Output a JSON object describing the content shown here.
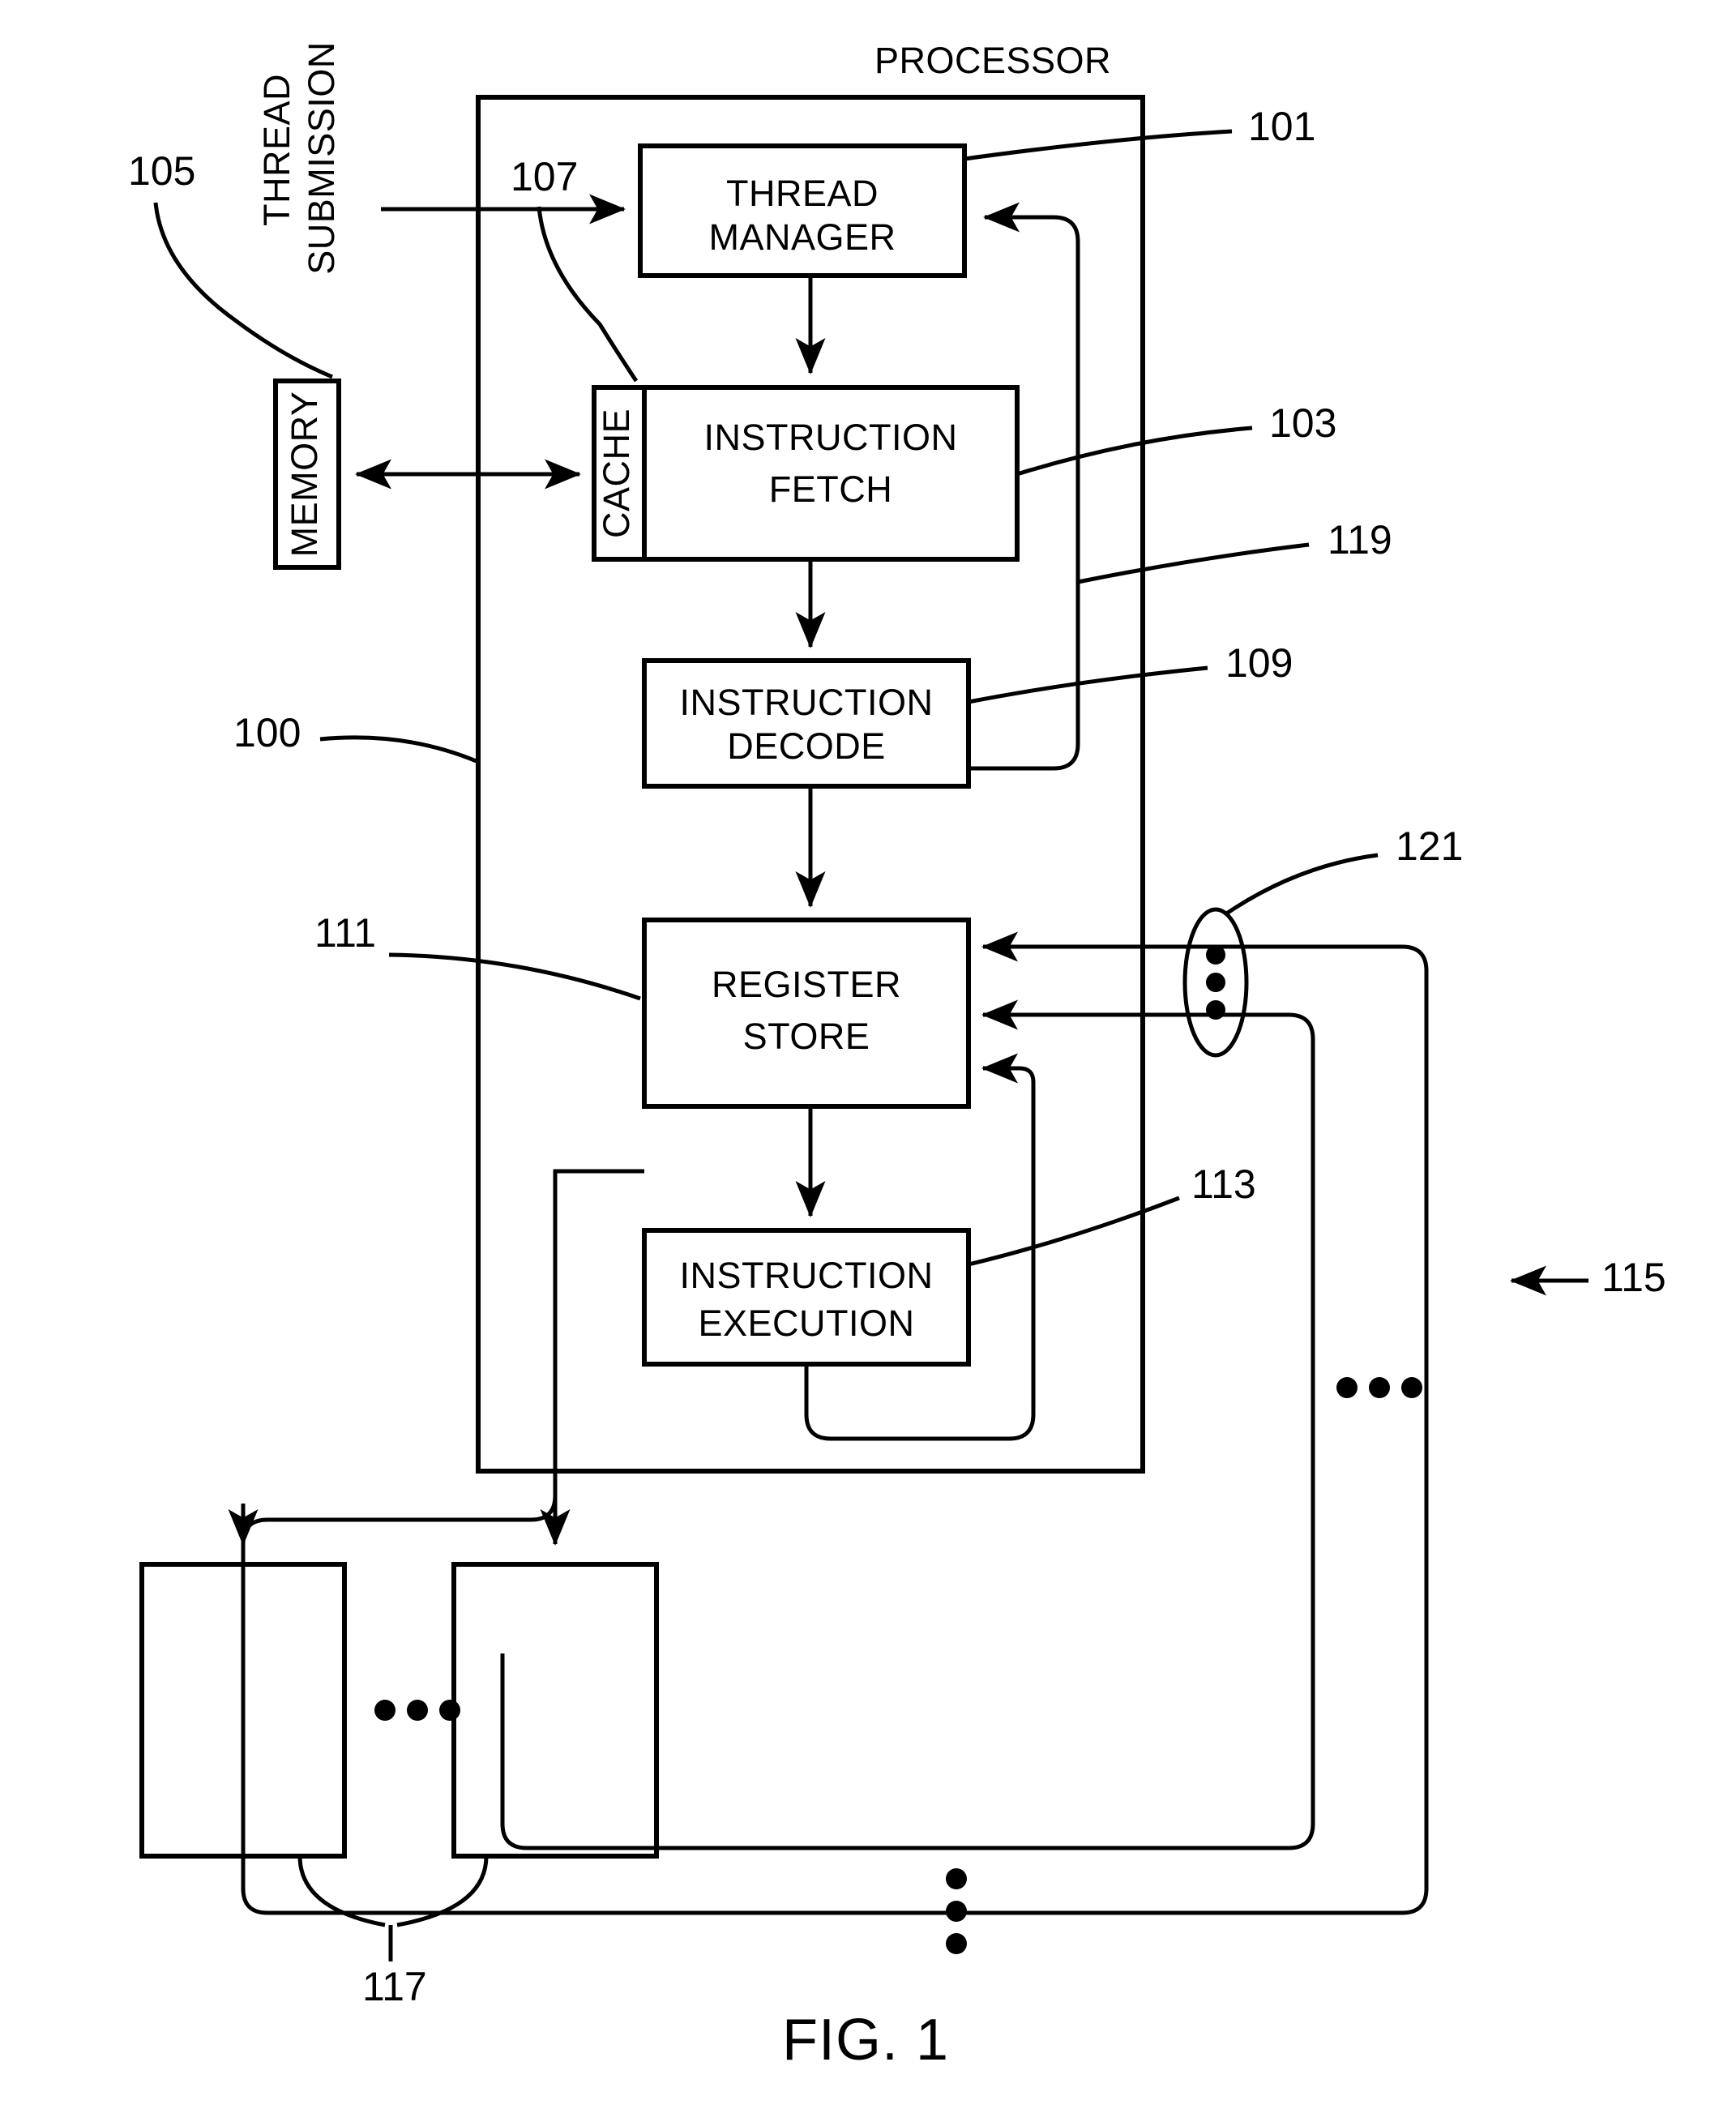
{
  "figure": {
    "caption": "FIG. 1",
    "outer_label": "PROCESSOR"
  },
  "blocks": {
    "thread_manager": {
      "line1": "THREAD",
      "line2": "MANAGER"
    },
    "instruction_fetch": {
      "line1": "INSTRUCTION",
      "line2": "FETCH"
    },
    "instruction_decode": {
      "line1": "INSTRUCTION",
      "line2": "DECODE"
    },
    "register_store": {
      "line1": "REGISTER",
      "line2": "STORE"
    },
    "instruction_execution": {
      "line1": "INSTRUCTION",
      "line2": "EXECUTION"
    },
    "memory": {
      "label": "MEMORY"
    },
    "cache": {
      "label": "CACHE"
    },
    "unit_left": {
      "label": ""
    },
    "unit_right": {
      "label": ""
    }
  },
  "annotations": {
    "thread_submission": {
      "line1": "THREAD",
      "line2": "SUBMISSION"
    }
  },
  "reference_numerals": {
    "processor_system": "100",
    "thread_manager": "101",
    "instruction_fetch": "103",
    "memory": "105",
    "cache": "107",
    "instruction_decode": "109",
    "register_store": "111",
    "instruction_execution": "113",
    "bus_return": "115",
    "functional_units": "117",
    "feedback_path": "119",
    "multi_path": "121"
  }
}
